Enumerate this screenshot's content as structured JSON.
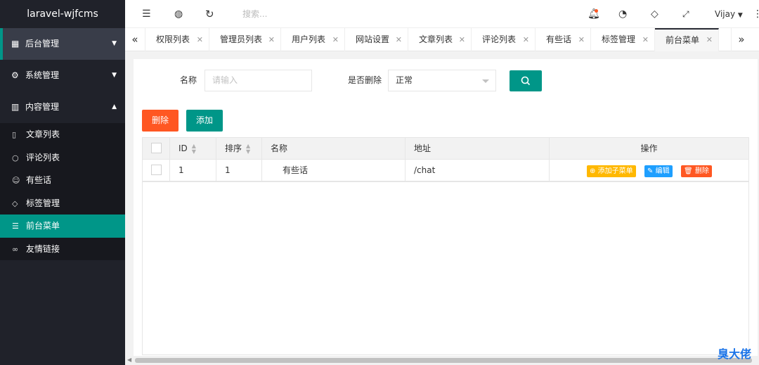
{
  "app": {
    "title": "laravel-wjfcms"
  },
  "sidebar": {
    "groups": [
      {
        "label": "后台管理",
        "icon": "grid-icon"
      },
      {
        "label": "系统管理",
        "icon": "gear-icon"
      },
      {
        "label": "内容管理",
        "icon": "books-icon"
      }
    ],
    "items": [
      {
        "label": "文章列表",
        "icon": "document-icon"
      },
      {
        "label": "评论列表",
        "icon": "comment-icon"
      },
      {
        "label": "有些话",
        "icon": "smile-icon"
      },
      {
        "label": "标签管理",
        "icon": "tag-icon"
      },
      {
        "label": "前台菜单",
        "icon": "menu-icon"
      },
      {
        "label": "友情链接",
        "icon": "link-icon"
      }
    ]
  },
  "header": {
    "search_placeholder": "搜索...",
    "user": "Vijay"
  },
  "tabs": [
    "权限列表",
    "管理员列表",
    "用户列表",
    "网站设置",
    "文章列表",
    "评论列表",
    "有些话",
    "标签管理",
    "前台菜单"
  ],
  "active_tab": "前台菜单",
  "filter": {
    "name_label": "名称",
    "name_placeholder": "请输入",
    "deleted_label": "是否删除",
    "deleted_value": "正常"
  },
  "actions": {
    "delete_label": "删除",
    "add_label": "添加"
  },
  "table": {
    "columns": [
      "ID",
      "排序",
      "名称",
      "地址",
      "操作"
    ],
    "rows": [
      {
        "id": "1",
        "sort": "1",
        "name": "有些话",
        "url": "/chat"
      }
    ],
    "row_actions": {
      "add_child": "添加子菜单",
      "edit": "编辑",
      "delete": "删除"
    }
  },
  "watermark": "臭大佬",
  "colors": {
    "accent": "#009688",
    "danger": "#ff5722",
    "warning": "#ffb800",
    "info": "#1e9fff",
    "sidebar": "#20222a"
  }
}
